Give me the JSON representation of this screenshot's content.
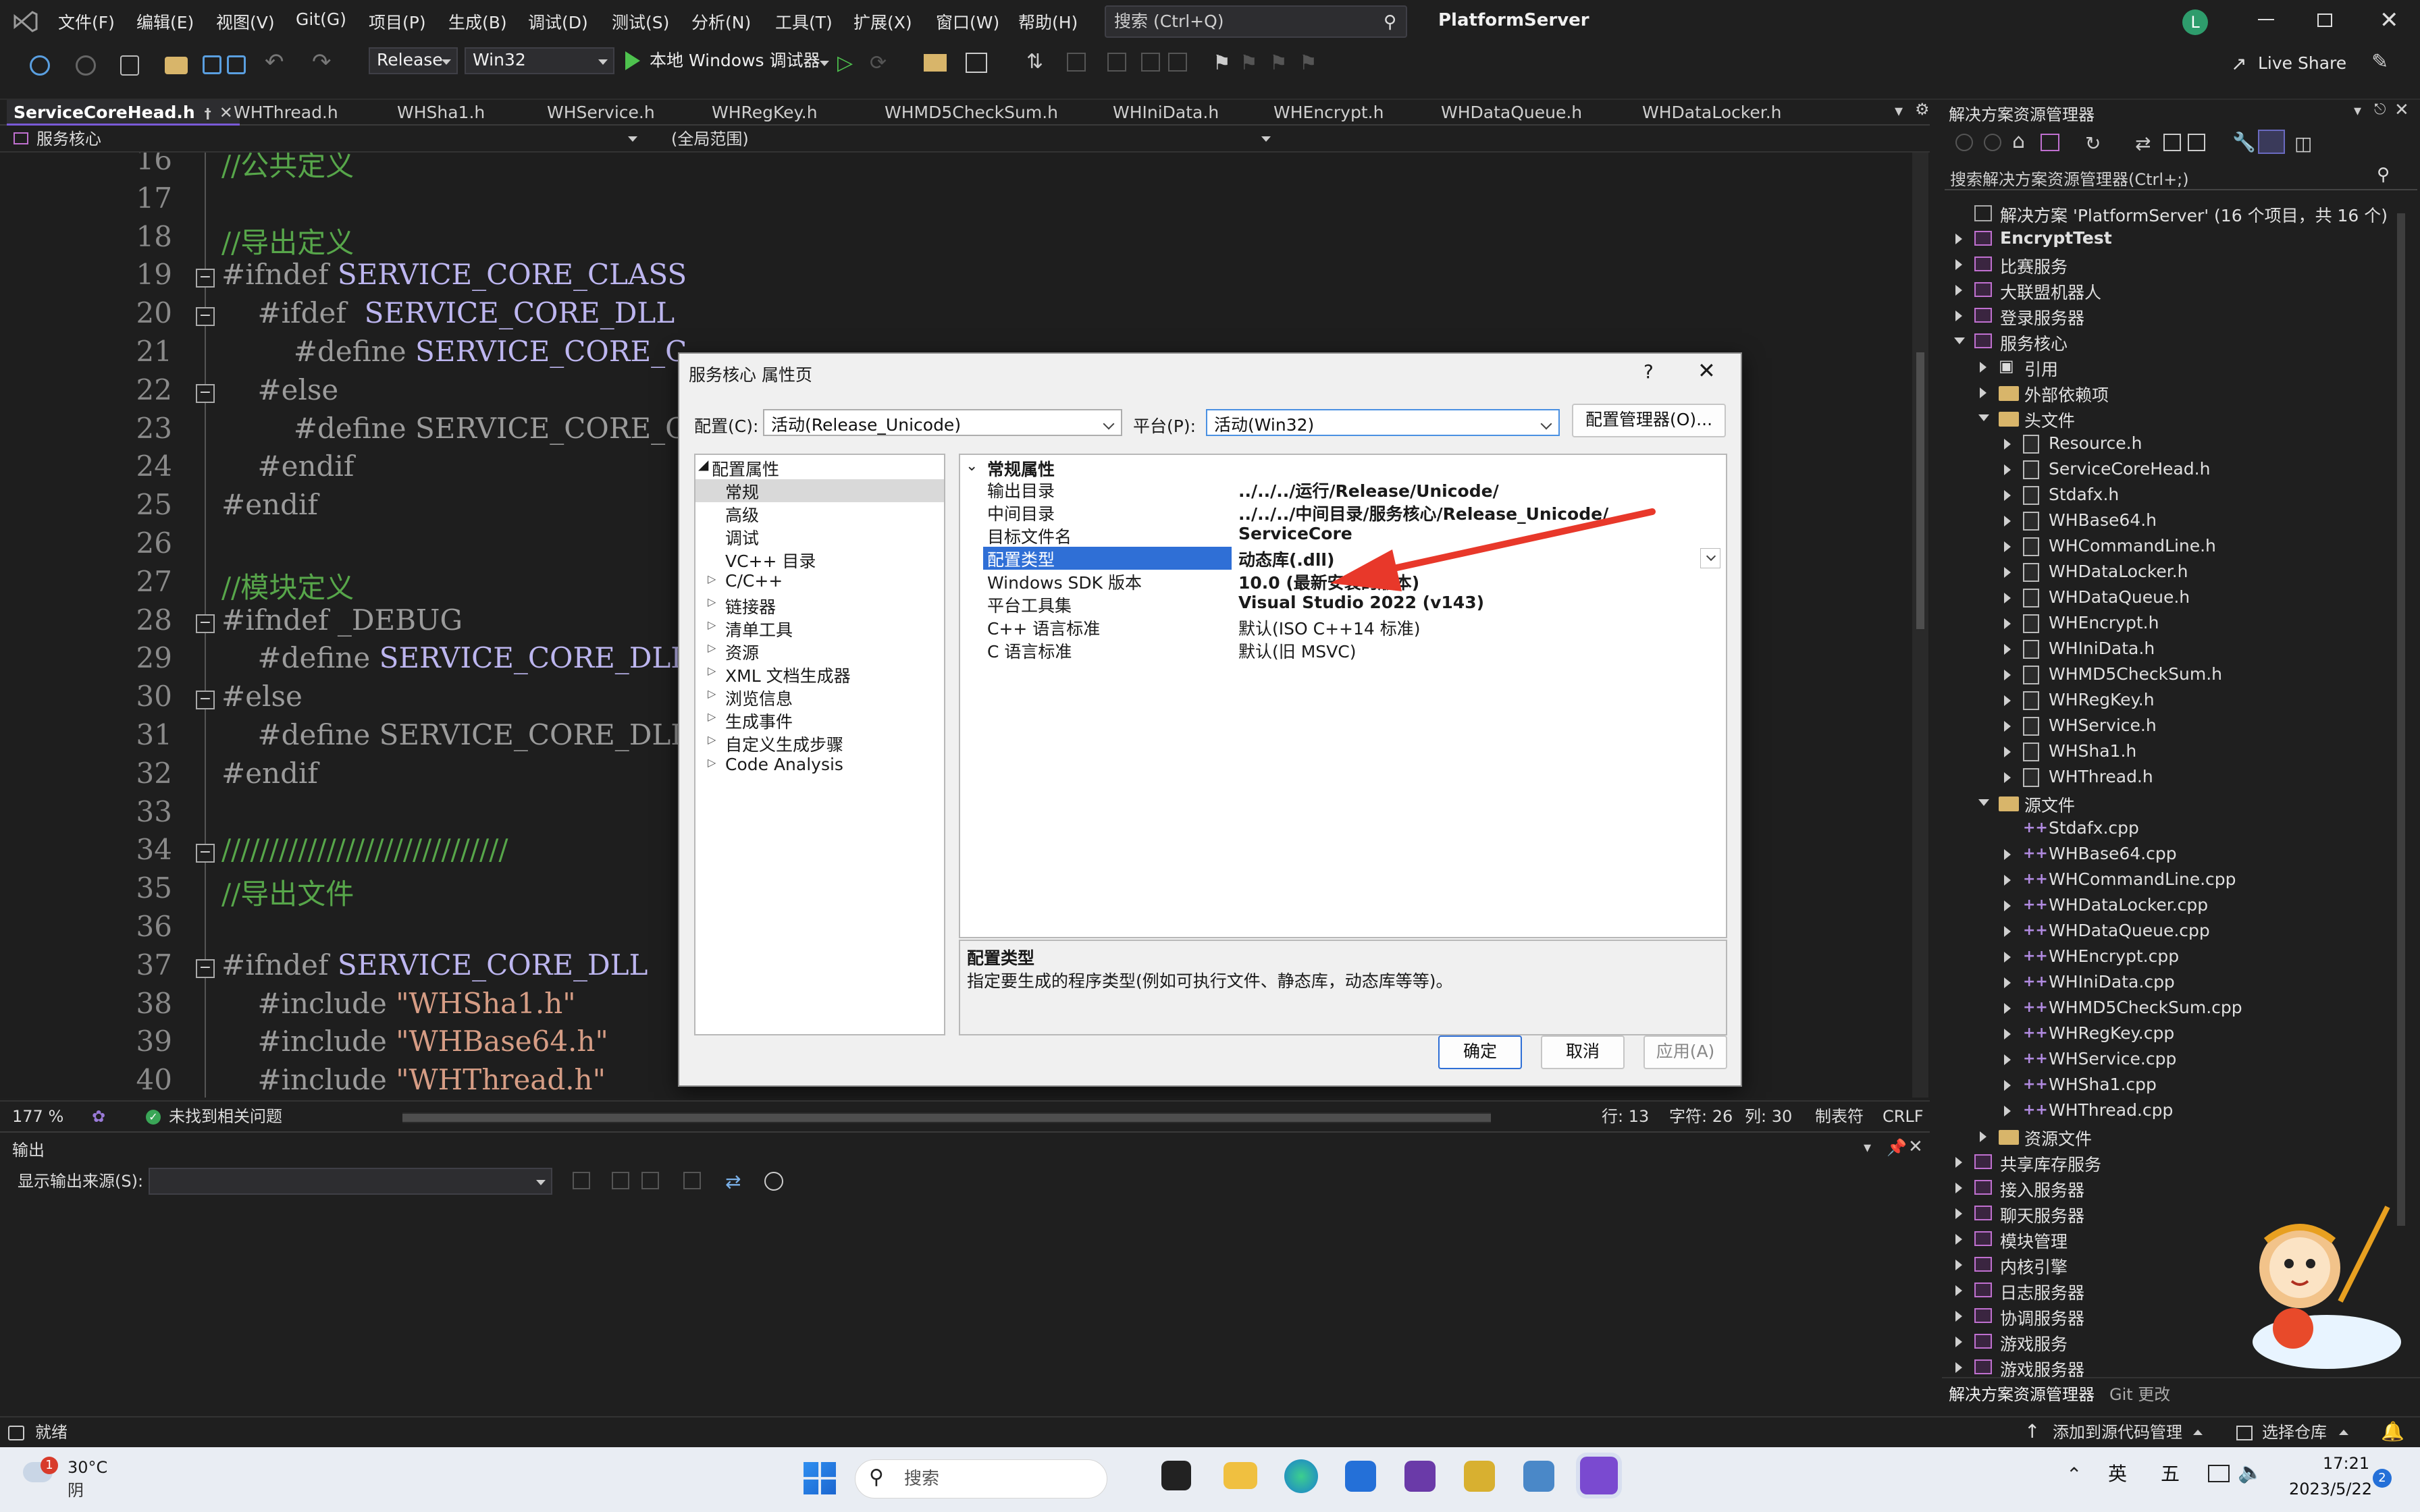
{
  "menubar": {
    "items": [
      "文件(F)",
      "编辑(E)",
      "视图(V)",
      "Git(G)",
      "项目(P)",
      "生成(B)",
      "调试(D)",
      "测试(S)",
      "分析(N)",
      "工具(T)",
      "扩展(X)",
      "窗口(W)",
      "帮助(H)"
    ],
    "search_placeholder": "搜索 (Ctrl+Q)",
    "solution_title": "PlatformServer",
    "avatar": "L"
  },
  "toolbar": {
    "config": "Release",
    "platform": "Win32",
    "run_label": "本地 Windows 调试器",
    "live_share": "Live Share"
  },
  "tabs": [
    "ServiceCoreHead.h",
    "WHThread.h",
    "WHSha1.h",
    "WHService.h",
    "WHRegKey.h",
    "WHMD5CheckSum.h",
    "WHIniData.h",
    "WHEncrypt.h",
    "WHDataQueue.h",
    "WHDataLocker.h"
  ],
  "nav": {
    "scope": "服务核心",
    "context": "(全局范围)"
  },
  "code": {
    "lines": [
      {
        "n": "16",
        "parts": [
          [
            "cmt",
            "//公共定义"
          ]
        ]
      },
      {
        "n": "17",
        "parts": []
      },
      {
        "n": "18",
        "parts": [
          [
            "cmt",
            "//导出定义"
          ]
        ]
      },
      {
        "n": "19",
        "parts": [
          [
            "kw",
            "#ifndef "
          ],
          [
            "mac",
            "SERVICE_CORE_CLASS"
          ]
        ]
      },
      {
        "n": "20",
        "parts": [
          [
            "kw",
            "    #ifdef  "
          ],
          [
            "mac",
            "SERVICE_CORE_DLL"
          ]
        ]
      },
      {
        "n": "21",
        "parts": [
          [
            "kw",
            "        #define "
          ],
          [
            "mac",
            "SERVICE_CORE_C"
          ]
        ]
      },
      {
        "n": "22",
        "parts": [
          [
            "kw",
            "    #else"
          ]
        ]
      },
      {
        "n": "23",
        "parts": [
          [
            "kw",
            "        #define SERVICE_CORE_C"
          ]
        ]
      },
      {
        "n": "24",
        "parts": [
          [
            "kw",
            "    #endif"
          ]
        ]
      },
      {
        "n": "25",
        "parts": [
          [
            "kw",
            "#endif"
          ]
        ]
      },
      {
        "n": "26",
        "parts": []
      },
      {
        "n": "27",
        "parts": [
          [
            "cmt",
            "//模块定义"
          ]
        ]
      },
      {
        "n": "28",
        "parts": [
          [
            "kw",
            "#ifndef _DEBUG"
          ]
        ]
      },
      {
        "n": "29",
        "parts": [
          [
            "kw",
            "    #define "
          ],
          [
            "mac",
            "SERVICE_CORE_DLL_N"
          ]
        ]
      },
      {
        "n": "30",
        "parts": [
          [
            "kw",
            "#else"
          ]
        ]
      },
      {
        "n": "31",
        "parts": [
          [
            "kw",
            "    #define SERVICE_CORE_DLL_N"
          ]
        ]
      },
      {
        "n": "32",
        "parts": [
          [
            "kw",
            "#endif"
          ]
        ]
      },
      {
        "n": "33",
        "parts": []
      },
      {
        "n": "34",
        "parts": [
          [
            "cmt",
            "//////////////////////////////"
          ]
        ]
      },
      {
        "n": "35",
        "parts": [
          [
            "cmt",
            "//导出文件"
          ]
        ]
      },
      {
        "n": "36",
        "parts": []
      },
      {
        "n": "37",
        "parts": [
          [
            "kw",
            "#ifndef "
          ],
          [
            "mac",
            "SERVICE_CORE_DLL"
          ]
        ]
      },
      {
        "n": "38",
        "parts": [
          [
            "kw",
            "    #include "
          ],
          [
            "str",
            "\"WHSha1.h\""
          ]
        ]
      },
      {
        "n": "39",
        "parts": [
          [
            "kw",
            "    #include "
          ],
          [
            "str",
            "\"WHBase64.h\""
          ]
        ]
      },
      {
        "n": "40",
        "parts": [
          [
            "kw",
            "    #include "
          ],
          [
            "str",
            "\"WHThread.h\""
          ]
        ]
      }
    ]
  },
  "dialog": {
    "title": "服务核心 属性页",
    "help": "?",
    "config_label": "配置(C):",
    "config_value": "活动(Release_Unicode)",
    "platform_label": "平台(P):",
    "platform_value": "活动(Win32)",
    "config_manager": "配置管理器(O)...",
    "tree_root": "配置属性",
    "tree": [
      "常规",
      "高级",
      "调试",
      "VC++ 目录",
      "C/C++",
      "链接器",
      "清单工具",
      "资源",
      "XML 文档生成器",
      "浏览信息",
      "生成事件",
      "自定义生成步骤",
      "Code Analysis"
    ],
    "section": "常规属性",
    "props": [
      {
        "name": "输出目录",
        "value": "../../../运行/Release/Unicode/"
      },
      {
        "name": "中间目录",
        "value": "../../../中间目录/服务核心/Release_Unicode/"
      },
      {
        "name": "目标文件名",
        "value": "ServiceCore"
      },
      {
        "name": "配置类型",
        "value": "动态库(.dll)"
      },
      {
        "name": "Windows SDK 版本",
        "value": "10.0 (最新安装的版本)"
      },
      {
        "name": "平台工具集",
        "value": "Visual Studio 2022 (v143)"
      },
      {
        "name": "C++ 语言标准",
        "value": "默认(ISO C++14 标准)"
      },
      {
        "name": "C 语言标准",
        "value": "默认(旧 MSVC)"
      }
    ],
    "desc_title": "配置类型",
    "desc_text": "指定要生成的程序类型(例如可执行文件、静态库，动态库等等)。",
    "ok": "确定",
    "cancel": "取消",
    "apply": "应用(A)"
  },
  "editor_status": {
    "zoom": "177 %",
    "issues": "未找到相关问题",
    "line": "行: 13",
    "char": "字符: 26",
    "col": "列: 30",
    "tabs": "制表符",
    "eol": "CRLF"
  },
  "output": {
    "title": "输出",
    "source_label": "显示输出来源(S):"
  },
  "solution_explorer": {
    "title": "解决方案资源管理器",
    "search": "搜索解决方案资源管理器(Ctrl+;)",
    "solution": "解决方案 'PlatformServer' (16 个项目，共 16 个)",
    "projects_top": [
      "EncryptTest",
      "比赛服务",
      "大联盟机器人",
      "登录服务器",
      "服务核心"
    ],
    "core_children": [
      "引用",
      "外部依赖项",
      "头文件"
    ],
    "headers": [
      "Resource.h",
      "ServiceCoreHead.h",
      "Stdafx.h",
      "WHBase64.h",
      "WHCommandLine.h",
      "WHDataLocker.h",
      "WHDataQueue.h",
      "WHEncrypt.h",
      "WHIniData.h",
      "WHMD5CheckSum.h",
      "WHRegKey.h",
      "WHService.h",
      "WHSha1.h",
      "WHThread.h"
    ],
    "source_folder": "源文件",
    "sources": [
      "Stdafx.cpp",
      "WHBase64.cpp",
      "WHCommandLine.cpp",
      "WHDataLocker.cpp",
      "WHDataQueue.cpp",
      "WHEncrypt.cpp",
      "WHIniData.cpp",
      "WHMD5CheckSum.cpp",
      "WHRegKey.cpp",
      "WHService.cpp",
      "WHSha1.cpp",
      "WHThread.cpp"
    ],
    "resource_folder": "资源文件",
    "projects_bottom": [
      "共享库存服务",
      "接入服务器",
      "聊天服务器",
      "模块管理",
      "内核引擎",
      "日志服务器",
      "协调服务器",
      "游戏服务",
      "游戏服务器"
    ],
    "bottom_tabs": [
      "解决方案资源管理器",
      "Git 更改"
    ]
  },
  "statusbar": {
    "ready": "就绪",
    "add_source": "添加到源代码管理",
    "select_repo": "选择仓库"
  },
  "taskbar": {
    "weather_badge": "1",
    "temp": "30°C",
    "weather": "阴",
    "search": "搜索",
    "ime1": "英",
    "ime2": "五",
    "time": "17:21",
    "date": "2023/5/22",
    "notif": "2"
  }
}
